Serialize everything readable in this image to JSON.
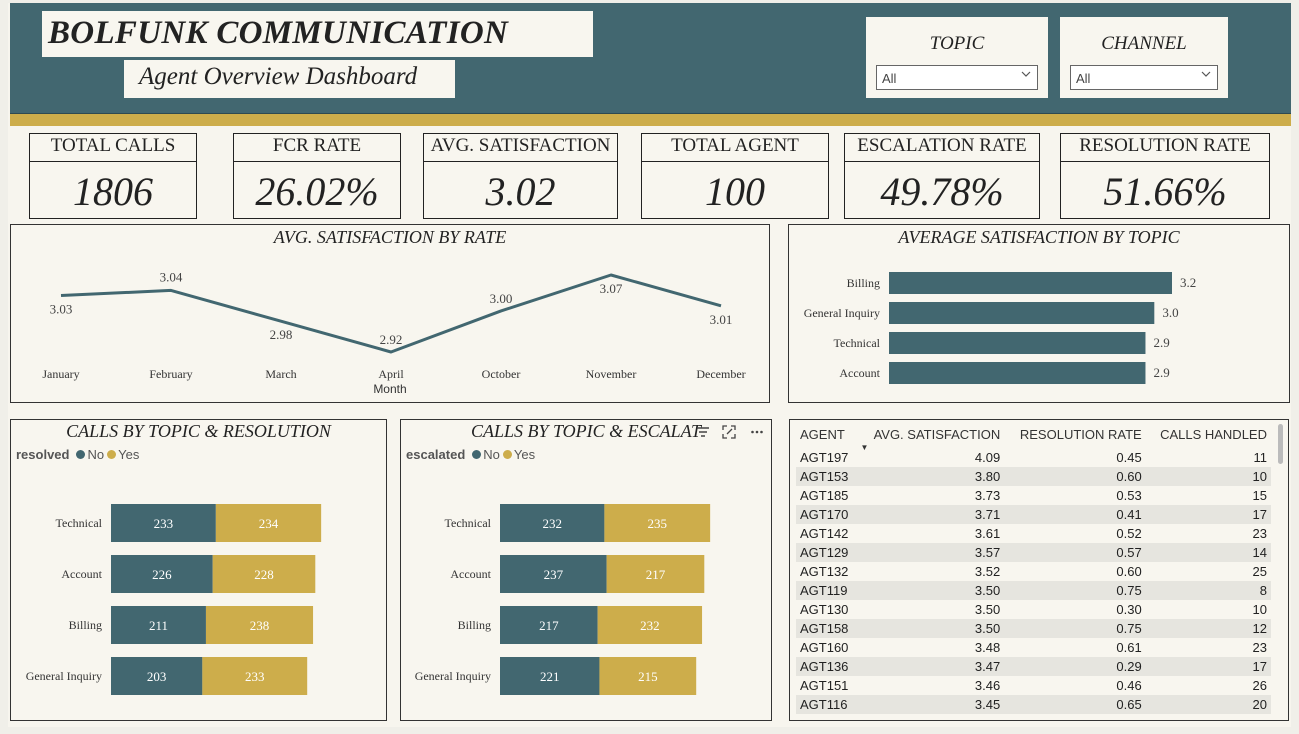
{
  "header": {
    "title": "BOLFUNK COMMUNICATION",
    "subtitle": "Agent Overview Dashboard",
    "colors": {
      "teal": "#426770",
      "gold": "#cdad4b",
      "background": "#f7f5ee"
    }
  },
  "slicers": [
    {
      "label": "TOPIC",
      "value": "All",
      "icon": "chevron-down-icon"
    },
    {
      "label": "CHANNEL",
      "value": "All",
      "icon": "chevron-down-icon"
    }
  ],
  "kpis": [
    {
      "label": "TOTAL CALLS",
      "value": "1806"
    },
    {
      "label": "FCR RATE",
      "value": "26.02%"
    },
    {
      "label": "AVG. SATISFACTION",
      "value": "3.02"
    },
    {
      "label": "TOTAL AGENT",
      "value": "100"
    },
    {
      "label": "ESCALATION RATE",
      "value": "49.78%"
    },
    {
      "label": "RESOLUTION RATE",
      "value": "51.66%"
    }
  ],
  "chart_data": [
    {
      "type": "line",
      "title": "AVG. SATISFACTION BY RATE",
      "xlabel": "Month",
      "ylabel": "",
      "categories": [
        "January",
        "February",
        "March",
        "April",
        "October",
        "November",
        "December"
      ],
      "values": [
        3.03,
        3.04,
        2.98,
        2.92,
        3.0,
        3.07,
        3.01
      ],
      "data_labels": [
        "3.03",
        "3.04",
        "2.98",
        "2.92",
        "3.00",
        "3.07",
        "3.01"
      ],
      "color": "#426770",
      "grid": false
    },
    {
      "type": "bar",
      "orientation": "horizontal",
      "title": "AVERAGE SATISFACTION BY TOPIC",
      "categories": [
        "Billing",
        "General Inquiry",
        "Technical",
        "Account"
      ],
      "values": [
        3.2,
        3.0,
        2.9,
        2.9
      ],
      "data_labels": [
        "3.2",
        "3.0",
        "2.9",
        "2.9"
      ],
      "color": "#426770",
      "grid": false
    },
    {
      "type": "bar",
      "orientation": "horizontal",
      "stacked": true,
      "title": "CALLS BY TOPIC & RESOLUTION",
      "legend_title": "resolved",
      "legend_position": "top-left",
      "categories": [
        "Technical",
        "Account",
        "Billing",
        "General Inquiry"
      ],
      "series": [
        {
          "name": "No",
          "color": "#426770",
          "values": [
            233,
            226,
            211,
            203
          ]
        },
        {
          "name": "Yes",
          "color": "#cdad4b",
          "values": [
            234,
            228,
            238,
            233
          ]
        }
      ]
    },
    {
      "type": "bar",
      "orientation": "horizontal",
      "stacked": true,
      "title": "CALLS BY TOPIC & ESCALAT",
      "legend_title": "escalated",
      "legend_position": "top-left",
      "categories": [
        "Technical",
        "Account",
        "Billing",
        "General Inquiry"
      ],
      "series": [
        {
          "name": "No",
          "color": "#426770",
          "values": [
            232,
            237,
            217,
            221
          ]
        },
        {
          "name": "Yes",
          "color": "#cdad4b",
          "values": [
            235,
            217,
            232,
            215
          ]
        }
      ]
    }
  ],
  "visual_header_icons": [
    "filter-icon",
    "focus-mode-icon",
    "more-options-icon"
  ],
  "agent_table": {
    "columns": [
      "AGENT",
      "AVG. SATISFACTION",
      "RESOLUTION RATE",
      "CALLS HANDLED"
    ],
    "sorted_column": "AVG. SATISFACTION",
    "sort_direction": "descending",
    "rows": [
      [
        "AGT197",
        "4.09",
        "0.45",
        "11"
      ],
      [
        "AGT153",
        "3.80",
        "0.60",
        "10"
      ],
      [
        "AGT185",
        "3.73",
        "0.53",
        "15"
      ],
      [
        "AGT170",
        "3.71",
        "0.41",
        "17"
      ],
      [
        "AGT142",
        "3.61",
        "0.52",
        "23"
      ],
      [
        "AGT129",
        "3.57",
        "0.57",
        "14"
      ],
      [
        "AGT132",
        "3.52",
        "0.60",
        "25"
      ],
      [
        "AGT119",
        "3.50",
        "0.75",
        "8"
      ],
      [
        "AGT130",
        "3.50",
        "0.30",
        "10"
      ],
      [
        "AGT158",
        "3.50",
        "0.75",
        "12"
      ],
      [
        "AGT160",
        "3.48",
        "0.61",
        "23"
      ],
      [
        "AGT136",
        "3.47",
        "0.29",
        "17"
      ],
      [
        "AGT151",
        "3.46",
        "0.46",
        "26"
      ],
      [
        "AGT116",
        "3.45",
        "0.65",
        "20"
      ]
    ]
  }
}
